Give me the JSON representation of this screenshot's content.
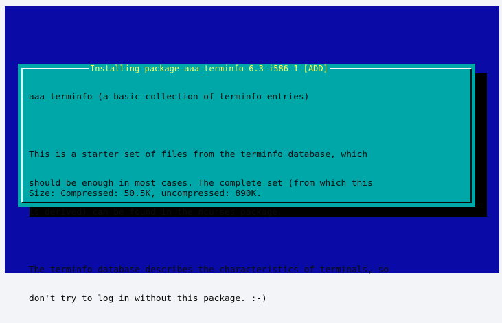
{
  "dialog": {
    "title": "Installing package aaa_terminfo-6.3-i586-1 [ADD]",
    "lines": [
      "aaa_terminfo (a basic collection of terminfo entries)",
      "",
      "This is a starter set of files from the terminfo database, which",
      "should be enough in most cases. The complete set (from which this",
      "is derived) can be found in the ncurses package.",
      "",
      "The terminfo database describes the characteristics of terminals, so",
      "don't try to log in without this package. :-)"
    ],
    "size_line": "Size: Compressed: 50.5K, uncompressed: 890K."
  },
  "colors": {
    "screen": "#0a0ba6",
    "dialog": "#00a7a8",
    "title": "#ffff54",
    "text": "#0b0b0b"
  }
}
